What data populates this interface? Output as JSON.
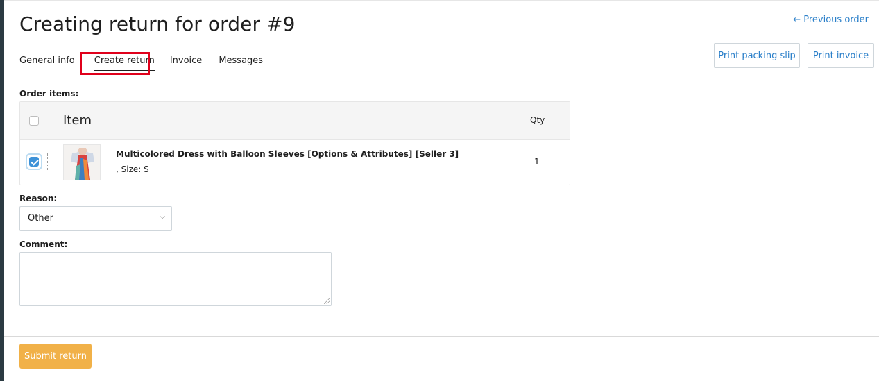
{
  "page": {
    "title": "Creating return for order #9",
    "previous_order": "← Previous order"
  },
  "tabs": [
    {
      "label": "General info"
    },
    {
      "label": "Create return",
      "active": true
    },
    {
      "label": "Invoice"
    },
    {
      "label": "Messages"
    }
  ],
  "actions": {
    "print_packing_slip": "Print packing slip",
    "print_invoice": "Print invoice"
  },
  "order_items": {
    "label": "Order items:",
    "columns": {
      "item": "Item",
      "qty": "Qty"
    },
    "rows": [
      {
        "name": "Multicolored Dress with Balloon Sleeves [Options & Attributes] [Seller 3]",
        "options": ", Size: S",
        "qty": "1",
        "checked": true
      }
    ]
  },
  "reason": {
    "label": "Reason:",
    "selected": "Other"
  },
  "comment": {
    "label": "Comment:",
    "value": ""
  },
  "submit": {
    "label": "Submit return"
  },
  "colors": {
    "link": "#2a7fc9",
    "submit": "#f1b148",
    "highlight": "#e0001b",
    "checkbox": "#3d92d8"
  }
}
